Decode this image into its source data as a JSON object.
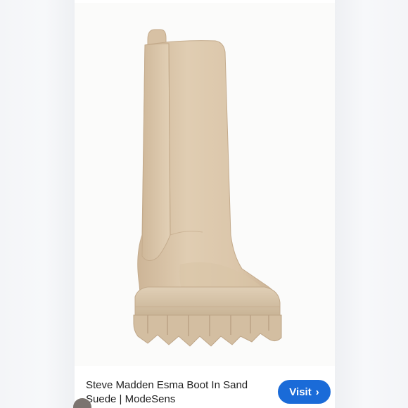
{
  "product": {
    "title": "Steve Madden Esma Boot In Sand Suede | ModeSens",
    "image_alt": "Sand suede knee-high lug sole boot"
  },
  "actions": {
    "visit_label": "Visit",
    "visit_icon": "chevron-right-icon",
    "visit_color": "#1a6bd8"
  },
  "colors": {
    "boot": "#dcc7ab",
    "sole": "#d6c3a8",
    "background": "#ffffff"
  }
}
